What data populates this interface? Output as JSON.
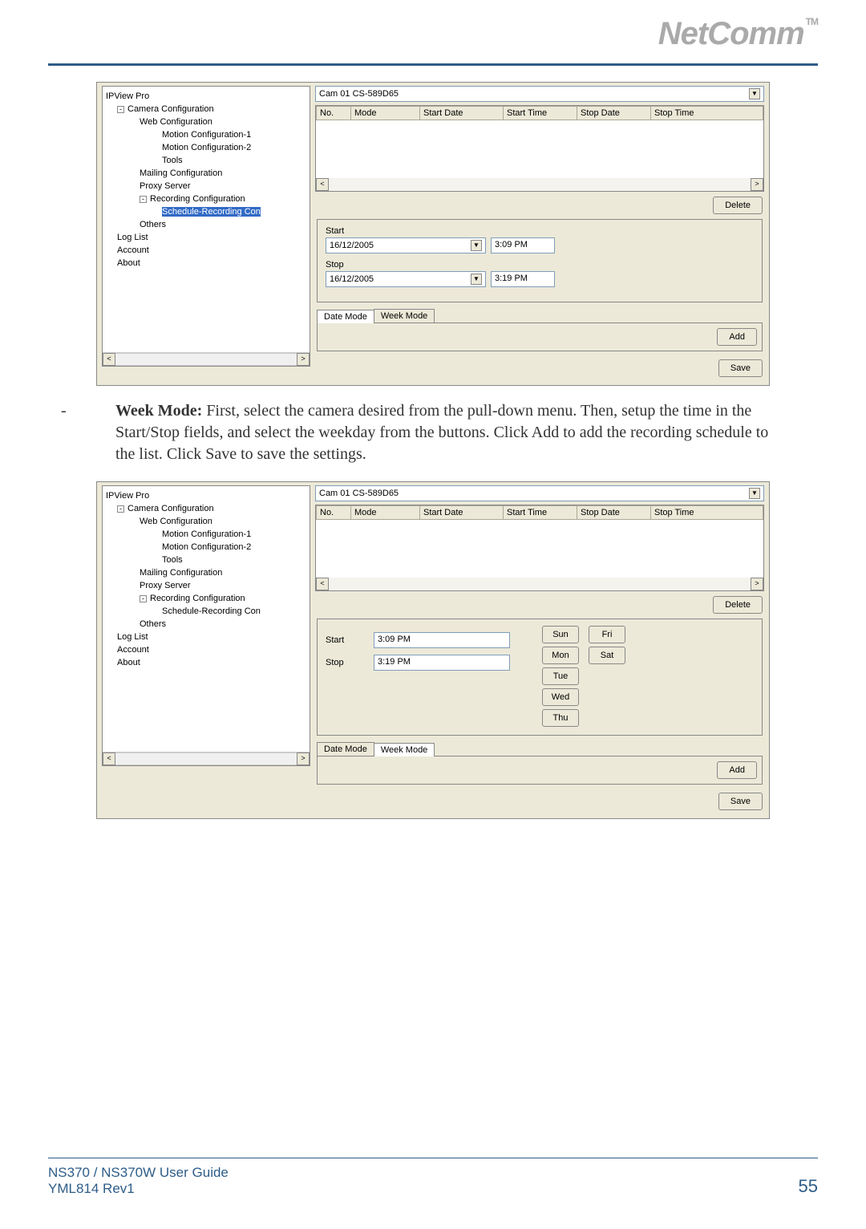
{
  "header": {
    "brand": "NetComm",
    "tm": "TM"
  },
  "app": {
    "title": "IPView Pro",
    "tree": {
      "root": "Camera Configuration",
      "web": "Web Configuration",
      "mc1": "Motion Configuration-1",
      "mc2": "Motion Configuration-2",
      "tools": "Tools",
      "mailing": "Mailing Configuration",
      "proxy": "Proxy Server",
      "recording": "Recording Configuration",
      "schedule": "Schedule-Recording Con",
      "others": "Others",
      "log": "Log List",
      "account": "Account",
      "about": "About"
    },
    "camSelect": "Cam 01    CS-589D65",
    "grid": {
      "no": "No.",
      "mode": "Mode",
      "startDate": "Start Date",
      "startTime": "Start Time",
      "stopDate": "Stop Date",
      "stopTime": "Stop Time"
    },
    "buttons": {
      "delete": "Delete",
      "add": "Add",
      "save": "Save"
    },
    "tabs": {
      "date": "Date Mode",
      "week": "Week Mode"
    },
    "dateMode": {
      "startLabel": "Start",
      "startDate": "16/12/2005",
      "startTime": "3:09 PM",
      "stopLabel": "Stop",
      "stopDate": "16/12/2005",
      "stopTime": "3:19 PM"
    },
    "weekMode": {
      "startLabel": "Start",
      "startTime": "3:09 PM",
      "stopLabel": "Stop",
      "stopTime": "3:19 PM",
      "days": {
        "sun": "Sun",
        "mon": "Mon",
        "tue": "Tue",
        "wed": "Wed",
        "thu": "Thu",
        "fri": "Fri",
        "sat": "Sat"
      }
    }
  },
  "body": {
    "weekMode": "Week Mode:",
    "weekModeText": " First, select the camera desired from the pull-down menu.  Then, setup the time in the Start/Stop fields, and select the weekday from the buttons.  Click Add to add the recording schedule to the list.  Click Save to save the settings."
  },
  "footer": {
    "guide": "NS370 / NS370W User Guide",
    "rev": "YML814 Rev1",
    "page": "55"
  }
}
